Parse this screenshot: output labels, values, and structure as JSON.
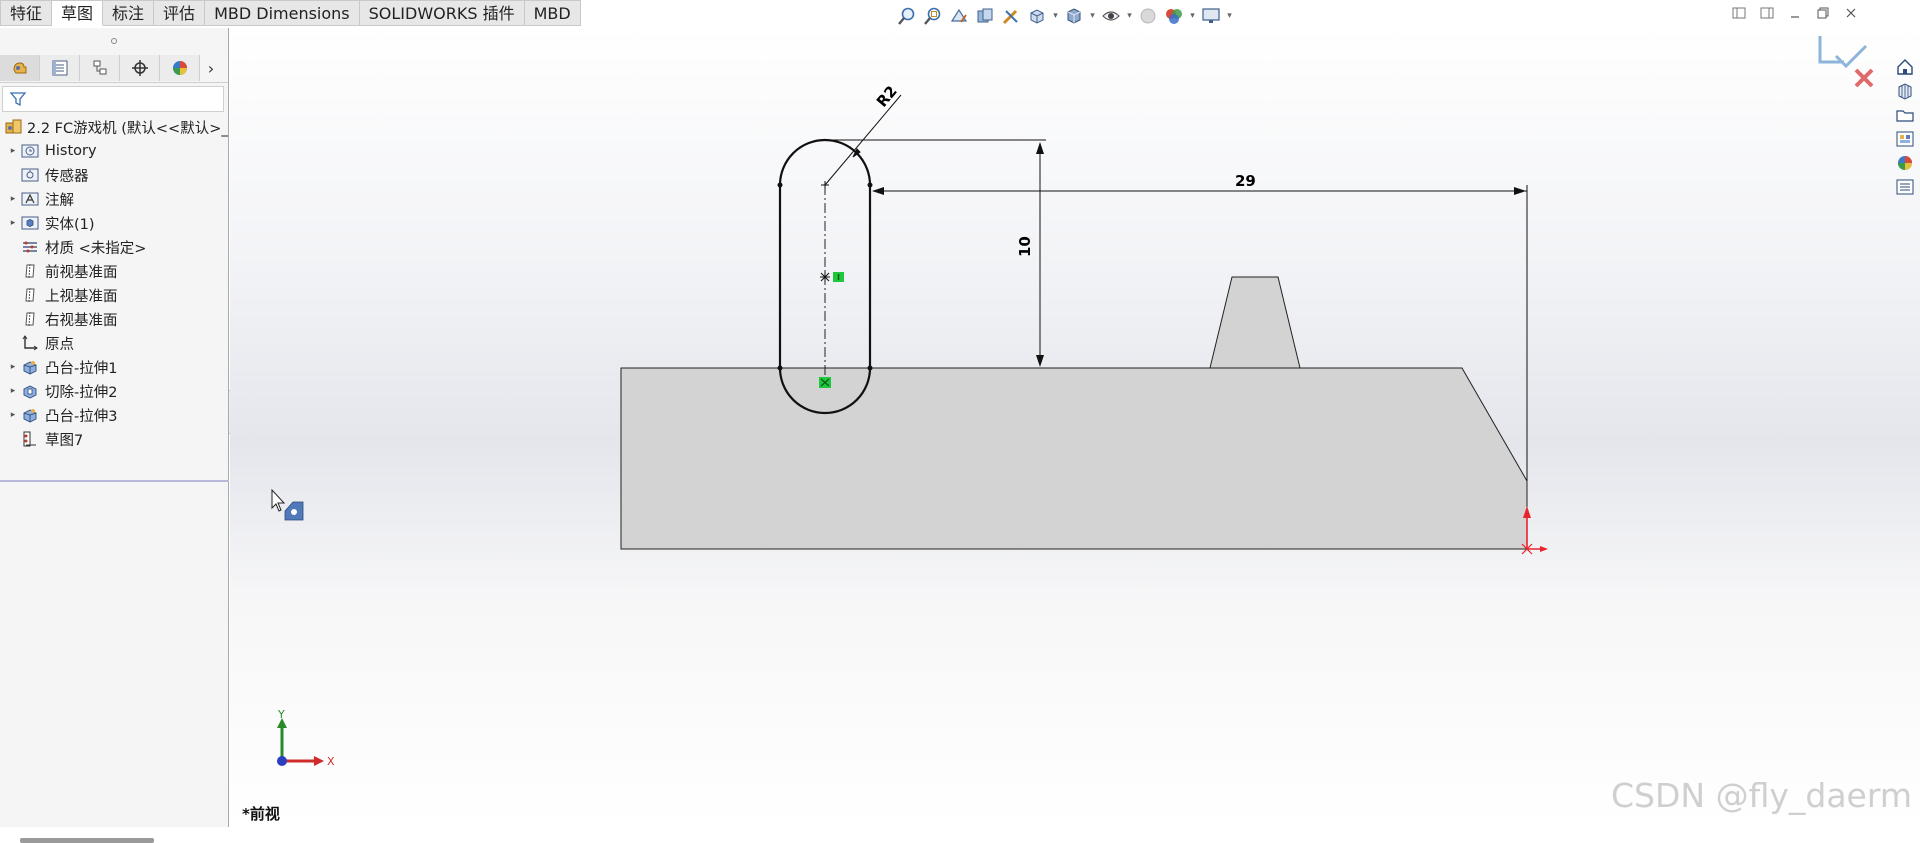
{
  "tabs": [
    "特征",
    "草图",
    "标注",
    "评估",
    "MBD Dimensions",
    "SOLIDWORKS 插件",
    "MBD"
  ],
  "active_tab": 1,
  "hud_icons": [
    "zoom-to-fit-icon",
    "zoom-area-icon",
    "previous-view-icon",
    "section-view-icon",
    "dynamic-annotation-icon",
    "view-orientation-icon",
    "display-style-icon",
    "hide-show-icon",
    "edit-appearance-icon",
    "apply-scene-icon",
    "view-settings-icon"
  ],
  "panel": {
    "tab_icons": [
      "feature-manager-icon",
      "property-manager-icon",
      "configuration-manager-icon",
      "dimxpert-icon",
      "display-manager-icon"
    ],
    "root_label": "2.2 FC游戏机 (默认<<默认>_",
    "tree": [
      {
        "label": "History",
        "icon": "history-icon",
        "expandable": true
      },
      {
        "label": "传感器",
        "icon": "sensor-icon",
        "expandable": false
      },
      {
        "label": "注解",
        "icon": "annotation-icon",
        "expandable": true
      },
      {
        "label": "实体(1)",
        "icon": "solid-body-icon",
        "expandable": true
      },
      {
        "label": "材质 <未指定>",
        "icon": "material-icon",
        "expandable": false
      },
      {
        "label": "前视基准面",
        "icon": "plane-icon",
        "expandable": false
      },
      {
        "label": "上视基准面",
        "icon": "plane-icon",
        "expandable": false
      },
      {
        "label": "右视基准面",
        "icon": "plane-icon",
        "expandable": false
      },
      {
        "label": "原点",
        "icon": "origin-icon",
        "expandable": false
      },
      {
        "label": "凸台-拉伸1",
        "icon": "boss-extrude-icon",
        "expandable": true
      },
      {
        "label": "切除-拉伸2",
        "icon": "cut-extrude-icon",
        "expandable": true
      },
      {
        "label": "凸台-拉伸3",
        "icon": "boss-extrude-icon",
        "expandable": true
      },
      {
        "label": "草图7",
        "icon": "sketch-icon",
        "expandable": false
      }
    ]
  },
  "sketch": {
    "dim_radius": "R2",
    "dim_height": "10",
    "dim_length": "29"
  },
  "triad": {
    "x": "X",
    "y": "Y"
  },
  "view_label": "*前视",
  "watermark": "CSDN @fly_daerm",
  "task_pane_icons": [
    "home-icon",
    "resources-icon",
    "design-library-icon",
    "view-palette-icon",
    "appearances-icon",
    "custom-properties-icon"
  ]
}
